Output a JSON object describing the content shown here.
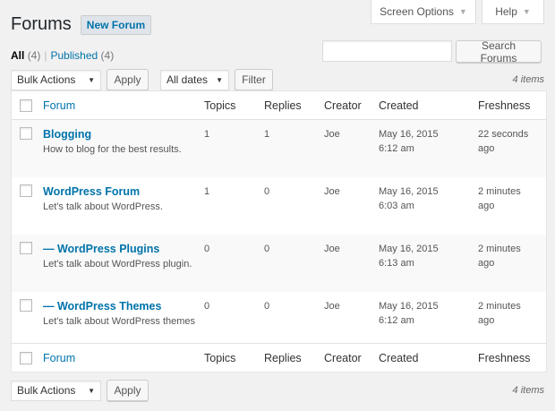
{
  "header": {
    "screen_options": "Screen Options",
    "help": "Help",
    "title": "Forums",
    "add_new": "New Forum"
  },
  "views": {
    "all_label": "All",
    "all_count": "(4)",
    "published_label": "Published",
    "published_count": "(4)",
    "separator": "|"
  },
  "search": {
    "value": "",
    "placeholder": "",
    "button": "Search Forums"
  },
  "tablenav_top": {
    "bulk_actions": "Bulk Actions",
    "apply": "Apply",
    "date_filter": "All dates",
    "filter": "Filter",
    "items": "4 items"
  },
  "tablenav_bottom": {
    "bulk_actions": "Bulk Actions",
    "apply": "Apply",
    "items": "4 items"
  },
  "columns": {
    "forum": "Forum",
    "topics": "Topics",
    "replies": "Replies",
    "creator": "Creator",
    "created": "Created",
    "freshness": "Freshness"
  },
  "rows": [
    {
      "title": "Blogging",
      "desc": "How to blog for the best results.",
      "topics": "1",
      "replies": "1",
      "creator": "Joe",
      "created_date": "May 16, 2015",
      "created_time": "6:12 am",
      "fresh_1": "22 seconds",
      "fresh_2": "ago"
    },
    {
      "title": "WordPress Forum",
      "desc": "Let's talk about WordPress.",
      "topics": "1",
      "replies": "0",
      "creator": "Joe",
      "created_date": "May 16, 2015",
      "created_time": "6:03 am",
      "fresh_1": "2 minutes",
      "fresh_2": "ago"
    },
    {
      "title": "— WordPress Plugins",
      "desc": "Let's talk about WordPress plugin.",
      "topics": "0",
      "replies": "0",
      "creator": "Joe",
      "created_date": "May 16, 2015",
      "created_time": "6:13 am",
      "fresh_1": "2 minutes",
      "fresh_2": "ago"
    },
    {
      "title": "— WordPress Themes",
      "desc": "Let's talk about WordPress themes",
      "topics": "0",
      "replies": "0",
      "creator": "Joe",
      "created_date": "May 16, 2015",
      "created_time": "6:12 am",
      "fresh_1": "2 minutes",
      "fresh_2": "ago"
    }
  ]
}
